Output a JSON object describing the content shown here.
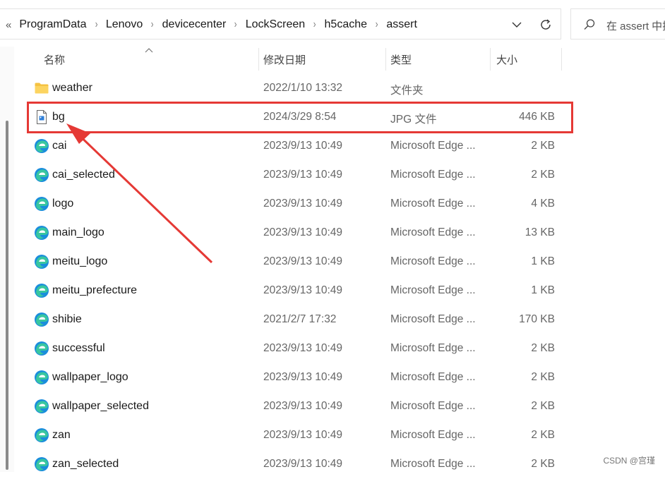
{
  "breadcrumb": {
    "lead": "«",
    "items": [
      "ProgramData",
      "Lenovo",
      "devicecenter",
      "LockScreen",
      "h5cache",
      "assert"
    ],
    "separator": "›"
  },
  "search": {
    "placeholder": "在 assert 中搜"
  },
  "columns": {
    "name": "名称",
    "date": "修改日期",
    "type": "类型",
    "size": "大小"
  },
  "files": [
    {
      "name": "weather",
      "date": "2022/1/10 13:32",
      "type": "文件夹",
      "size": "",
      "icon": "folder-icon"
    },
    {
      "name": "bg",
      "date": "2024/3/29 8:54",
      "type": "JPG 文件",
      "size": "446 KB",
      "icon": "image-file-icon",
      "highlighted": true
    },
    {
      "name": "cai",
      "date": "2023/9/13 10:49",
      "type": "Microsoft Edge ...",
      "size": "2 KB",
      "icon": "edge-icon"
    },
    {
      "name": "cai_selected",
      "date": "2023/9/13 10:49",
      "type": "Microsoft Edge ...",
      "size": "2 KB",
      "icon": "edge-icon"
    },
    {
      "name": "logo",
      "date": "2023/9/13 10:49",
      "type": "Microsoft Edge ...",
      "size": "4 KB",
      "icon": "edge-icon"
    },
    {
      "name": "main_logo",
      "date": "2023/9/13 10:49",
      "type": "Microsoft Edge ...",
      "size": "13 KB",
      "icon": "edge-icon"
    },
    {
      "name": "meitu_logo",
      "date": "2023/9/13 10:49",
      "type": "Microsoft Edge ...",
      "size": "1 KB",
      "icon": "edge-icon"
    },
    {
      "name": "meitu_prefecture",
      "date": "2023/9/13 10:49",
      "type": "Microsoft Edge ...",
      "size": "1 KB",
      "icon": "edge-icon"
    },
    {
      "name": "shibie",
      "date": "2021/2/7 17:32",
      "type": "Microsoft Edge ...",
      "size": "170 KB",
      "icon": "edge-icon"
    },
    {
      "name": "successful",
      "date": "2023/9/13 10:49",
      "type": "Microsoft Edge ...",
      "size": "2 KB",
      "icon": "edge-icon"
    },
    {
      "name": "wallpaper_logo",
      "date": "2023/9/13 10:49",
      "type": "Microsoft Edge ...",
      "size": "2 KB",
      "icon": "edge-icon"
    },
    {
      "name": "wallpaper_selected",
      "date": "2023/9/13 10:49",
      "type": "Microsoft Edge ...",
      "size": "2 KB",
      "icon": "edge-icon"
    },
    {
      "name": "zan",
      "date": "2023/9/13 10:49",
      "type": "Microsoft Edge ...",
      "size": "2 KB",
      "icon": "edge-icon"
    },
    {
      "name": "zan_selected",
      "date": "2023/9/13 10:49",
      "type": "Microsoft Edge ...",
      "size": "2 KB",
      "icon": "edge-icon"
    }
  ],
  "watermark": "CSDN @宫瑾",
  "colors": {
    "highlight": "#e53935",
    "folder": "#f5c242",
    "edge": "#1e88e5"
  }
}
